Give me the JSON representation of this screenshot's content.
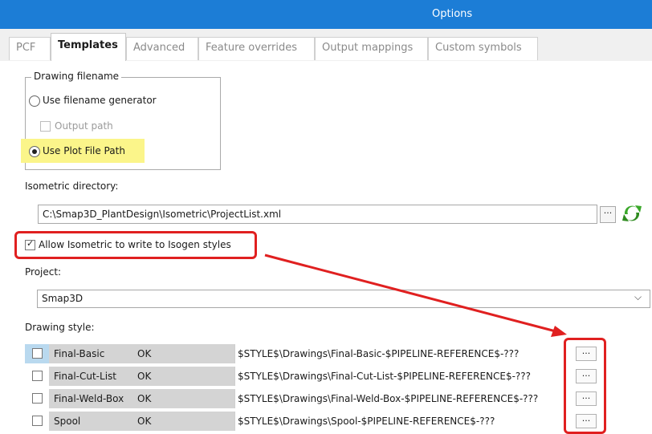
{
  "window": {
    "title": "Options"
  },
  "tabs": [
    {
      "label": "PCF",
      "active": false
    },
    {
      "label": "Templates",
      "active": true
    },
    {
      "label": "Advanced",
      "active": false
    },
    {
      "label": "Feature overrides",
      "active": false
    },
    {
      "label": "Output mappings",
      "active": false
    },
    {
      "label": "Custom symbols",
      "active": false
    }
  ],
  "drawing_filename": {
    "legend": "Drawing filename",
    "option_generator": "Use filename generator",
    "output_path": "Output path",
    "option_plot_path": "Use Plot File Path",
    "selected": "Use Plot File Path"
  },
  "isometric_directory": {
    "label": "Isometric directory:",
    "value": "C:\\Smap3D_PlantDesign\\Isometric\\ProjectList.xml",
    "browse_label": "...",
    "refresh_icon": "refresh-icon"
  },
  "allow_write": {
    "label": "Allow Isometric to write to Isogen styles",
    "checked": true
  },
  "project": {
    "label": "Project:",
    "value": "Smap3D"
  },
  "drawing_style": {
    "label": "Drawing style:",
    "rows": [
      {
        "name": "Final-Basic",
        "status": "OK",
        "path": "$STYLE$\\Drawings\\Final-Basic-$PIPELINE-REFERENCE$-???",
        "button": "..."
      },
      {
        "name": "Final-Cut-List",
        "status": "OK",
        "path": "$STYLE$\\Drawings\\Final-Cut-List-$PIPELINE-REFERENCE$-???",
        "button": "..."
      },
      {
        "name": "Final-Weld-Box",
        "status": "OK",
        "path": "$STYLE$\\Drawings\\Final-Weld-Box-$PIPELINE-REFERENCE$-???",
        "button": "..."
      },
      {
        "name": "Spool",
        "status": "OK",
        "path": "$STYLE$\\Drawings\\Spool-$PIPELINE-REFERENCE$-???",
        "button": "..."
      }
    ]
  },
  "colors": {
    "titlebar": "#1c7dd6",
    "highlight": "#fbf58a",
    "annotation": "#e02020"
  }
}
